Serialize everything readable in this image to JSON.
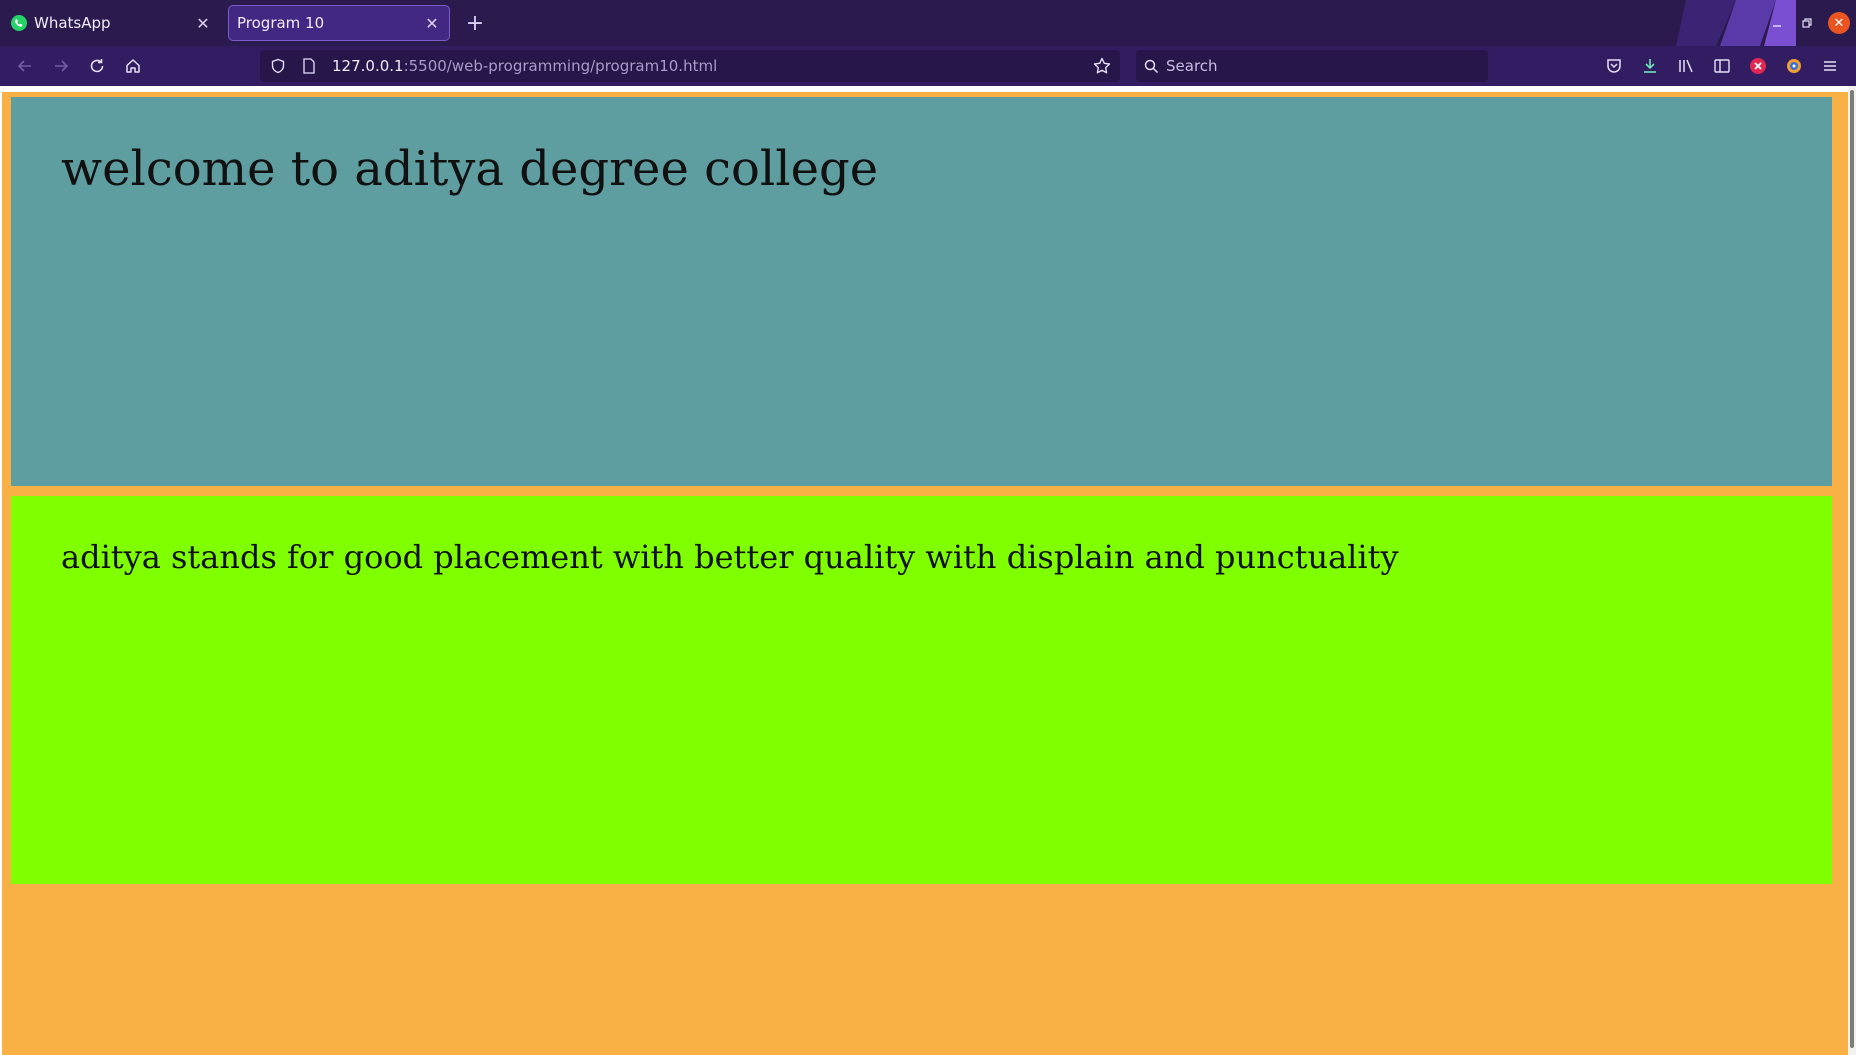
{
  "browser": {
    "tabs": [
      {
        "label": "WhatsApp",
        "active": false,
        "favicon": "whatsapp-icon"
      },
      {
        "label": "Program 10",
        "active": true,
        "favicon": ""
      }
    ],
    "new_tab_icon": "plus-icon",
    "window_controls": [
      "minimize-icon",
      "restore-icon",
      "close-icon"
    ],
    "url_host": "127.0.0.1",
    "url_path": ":5500/web-programming/program10.html",
    "search_placeholder": "Search",
    "colors": {
      "tabbar": "#2a1a4e",
      "active_tab": "#432883",
      "navbar": "#321d62",
      "urlbar": "#26164a",
      "close_button": "#e95420"
    }
  },
  "page": {
    "header_text": "welcome to aditya degree college",
    "body_text": "aditya stands for good placement with better quality with displain and punctuality",
    "colors": {
      "background": "#f9b044",
      "header_block": "#5f9ea0",
      "body_block": "#7fff00"
    }
  }
}
